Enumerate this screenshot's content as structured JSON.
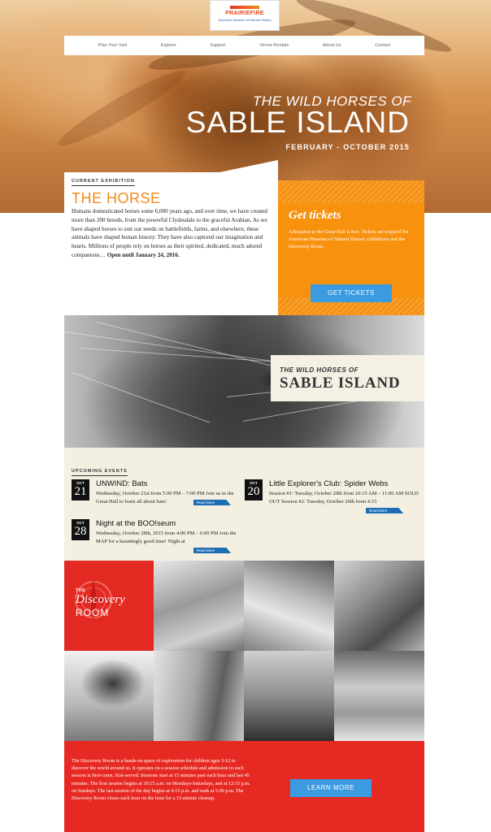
{
  "logo": {
    "wordmark": "PRAIRIEFIRE",
    "sub": "American Museum of Natural History"
  },
  "nav": [
    "Plan Your Visit",
    "Explore",
    "Support",
    "Venue Rentals",
    "About Us",
    "Contact"
  ],
  "hero": {
    "subtitle": "THE WILD HORSES OF",
    "title": "SABLE ISLAND",
    "dates": "FEBRUARY - OCTOBER 2015"
  },
  "exhibition": {
    "label": "CURRENT EXHIBITION",
    "title": "THE HORSE",
    "body": "Humans domesticated horses some 6,000 years ago, and over time, we have created more than 200 breeds, from the powerful Clydesdale to the graceful Arabian. As we have shaped horses to suit our needs on battlefields, farms, and elsewhere, these animals have shaped human history. They have also captured our imagination and hearts. Millions of people rely on horses as their spirited, dedicated, much adored companions…",
    "open_until": "Open until January 24, 2016."
  },
  "tickets": {
    "title": "Get tickets",
    "body": "Admission to the Great Hall is free. Tickets are required for American Museum of Natural History exhibitions and the Discovery Room.",
    "button": "GET TICKETS"
  },
  "feature": {
    "subtitle": "THE WILD HORSES OF",
    "title": "SABLE ISLAND"
  },
  "events": {
    "label": "UPCOMING EVENTS",
    "items": [
      {
        "month": "OCT",
        "day": "21",
        "title": "UNWIND: Bats",
        "desc": "Wednesday, October 21st from 5:00 PM – 7:00 PM Join us in the Great Hall to learn all about bats!",
        "more": "Read More"
      },
      {
        "month": "OCT",
        "day": "20",
        "title": "Little Explorer's Club: Spider Webs",
        "desc": "Session #1: Tuesday, October 20th from 10:15 AM – 11:00 AM SOLD OUT Session #2: Tuesday, October 20th from 4:15",
        "more": "Read More"
      },
      {
        "month": "OCT",
        "day": "28",
        "title": "Night at the BOO!seum",
        "desc": "Wednesday, October 28th, 2015 from 4:00 PM – 6:00 PM Join the MAP for a hauntingly good time! Night at",
        "more": "Read More"
      }
    ]
  },
  "discovery": {
    "the": "THE",
    "word": "Discovery",
    "room": "ROOM",
    "body": "The Discovery Room is a hands-on space of exploration for children ages 3-12 to discover the world around us. It operates on a session schedule and admission to each session is first-come, first-served. Sessions start at 15 minutes past each hour and last 45 minutes. The first session begins at 10:15 a.m. on Mondays-Saturdays, and at 12:15 p.m. on Sundays. The last session of the day begins at 4:15 p.m. and ends at 5:00 p.m. The Discovery Room closes each hour on the hour for a 15-minute cleanup.",
    "button": "LEARN MORE"
  },
  "colors": {
    "orange": "#f7910e",
    "red": "#e62a23",
    "blue": "#3b9be0",
    "cream": "#f3f0e2"
  }
}
